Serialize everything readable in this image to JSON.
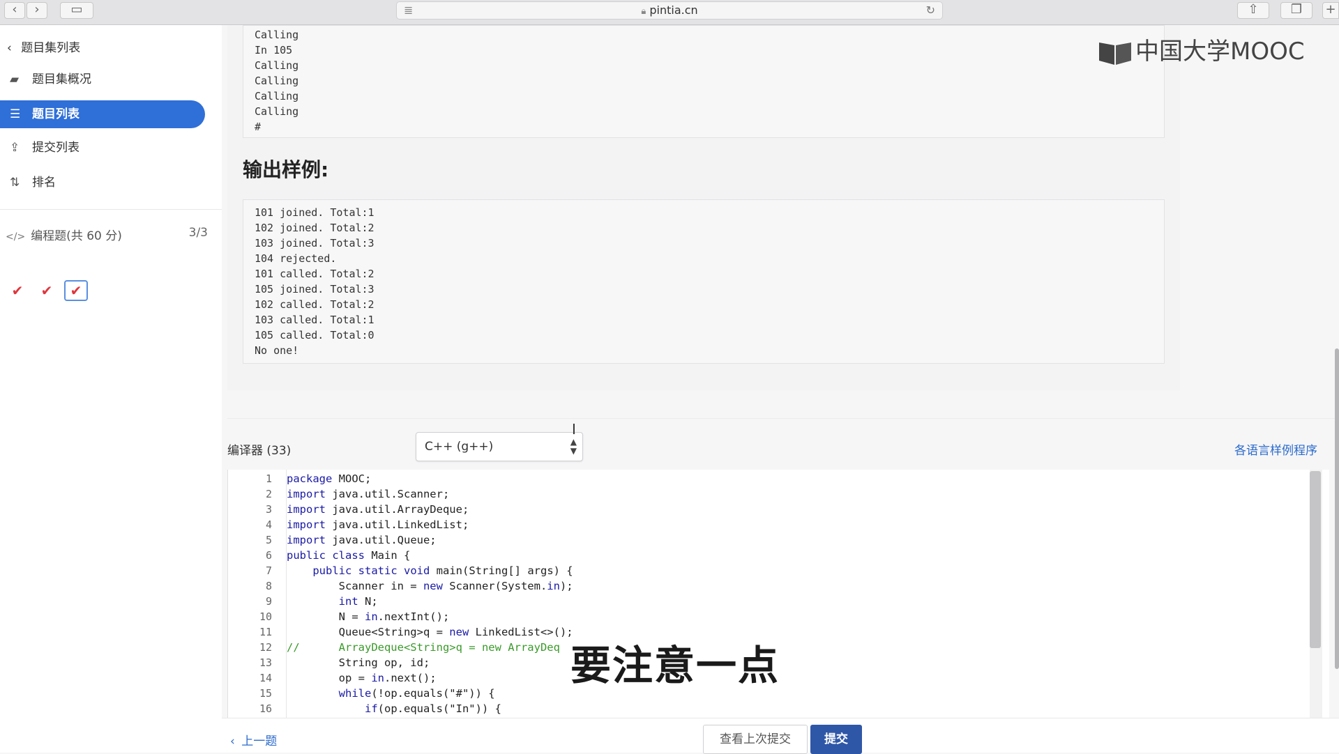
{
  "browser": {
    "url": "pintia.cn",
    "back_icon": "‹",
    "forward_icon": "›"
  },
  "logo": {
    "text": "中国大学MOOC"
  },
  "sidebar": {
    "back_label": "题目集列表",
    "items": [
      {
        "label": "题目集概况",
        "icon": "book-icon",
        "glyph": "▰"
      },
      {
        "label": "题目列表",
        "icon": "list-icon",
        "glyph": "☰"
      },
      {
        "label": "提交列表",
        "icon": "upload-icon",
        "glyph": "⇪"
      },
      {
        "label": "排名",
        "icon": "rank-icon",
        "glyph": "⇅"
      }
    ],
    "section_title": "编程题(共 60 分)",
    "section_icon": "</>",
    "section_count": "3/3",
    "checks": [
      "✔",
      "✔",
      "✔"
    ]
  },
  "input_sample_tail": [
    "Calling",
    "In 105",
    "Calling",
    "Calling",
    "Calling",
    "Calling",
    "#"
  ],
  "output_heading": "输出样例:",
  "output_sample": [
    "101 joined. Total:1",
    "102 joined. Total:2",
    "103 joined. Total:3",
    "104 rejected.",
    "101 called. Total:2",
    "105 joined. Total:3",
    "102 called. Total:2",
    "103 called. Total:1",
    "105 called. Total:0",
    "No one!"
  ],
  "compiler": {
    "label": "编译器 (33)",
    "selected": "C++ (g++)",
    "examples_link": "各语言样例程序"
  },
  "code_lines": [
    "package MOOC;",
    "import java.util.Scanner;",
    "import java.util.ArrayDeque;",
    "import java.util.LinkedList;",
    "import java.util.Queue;",
    "public class Main {",
    "    public static void main(String[] args) {",
    "        Scanner in = new Scanner(System.in);",
    "        int N;",
    "        N = in.nextInt();",
    "        Queue<String>q = new LinkedList<>();",
    "//      ArrayDeque<String>q = new ArrayDeq",
    "        String op, id;",
    "        op = in.next();",
    "        while(!op.equals(\"#\")) {",
    "            if(op.equals(\"In\")) {"
  ],
  "subtitle": "要注意一点",
  "footer": {
    "prev_label": "上一题",
    "view_last_label": "查看上次提交",
    "submit_label": "提交"
  }
}
